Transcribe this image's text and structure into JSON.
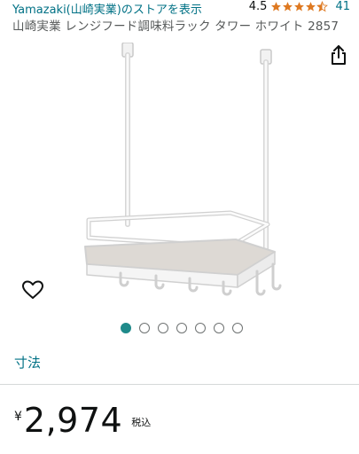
{
  "header": {
    "store_link": "Yamazaki(山崎実業)のストアを表示",
    "rating_value": "4.5",
    "rating_stars": 4.5,
    "rating_count": "41"
  },
  "product": {
    "title": "山崎実業 レンジフード調味料ラック タワー ホワイト 2857"
  },
  "icons": {
    "share": "share-icon",
    "wishlist": "heart-outline-icon",
    "star": "star-icon"
  },
  "carousel": {
    "total": 7,
    "active_index": 0
  },
  "sections": {
    "dimension_label": "寸法"
  },
  "pricing": {
    "currency": "¥",
    "amount": "2,974",
    "tax_note": "税込"
  },
  "colors": {
    "link": "#007185",
    "star": "#de7921",
    "active_dot": "#1f8a8a"
  }
}
